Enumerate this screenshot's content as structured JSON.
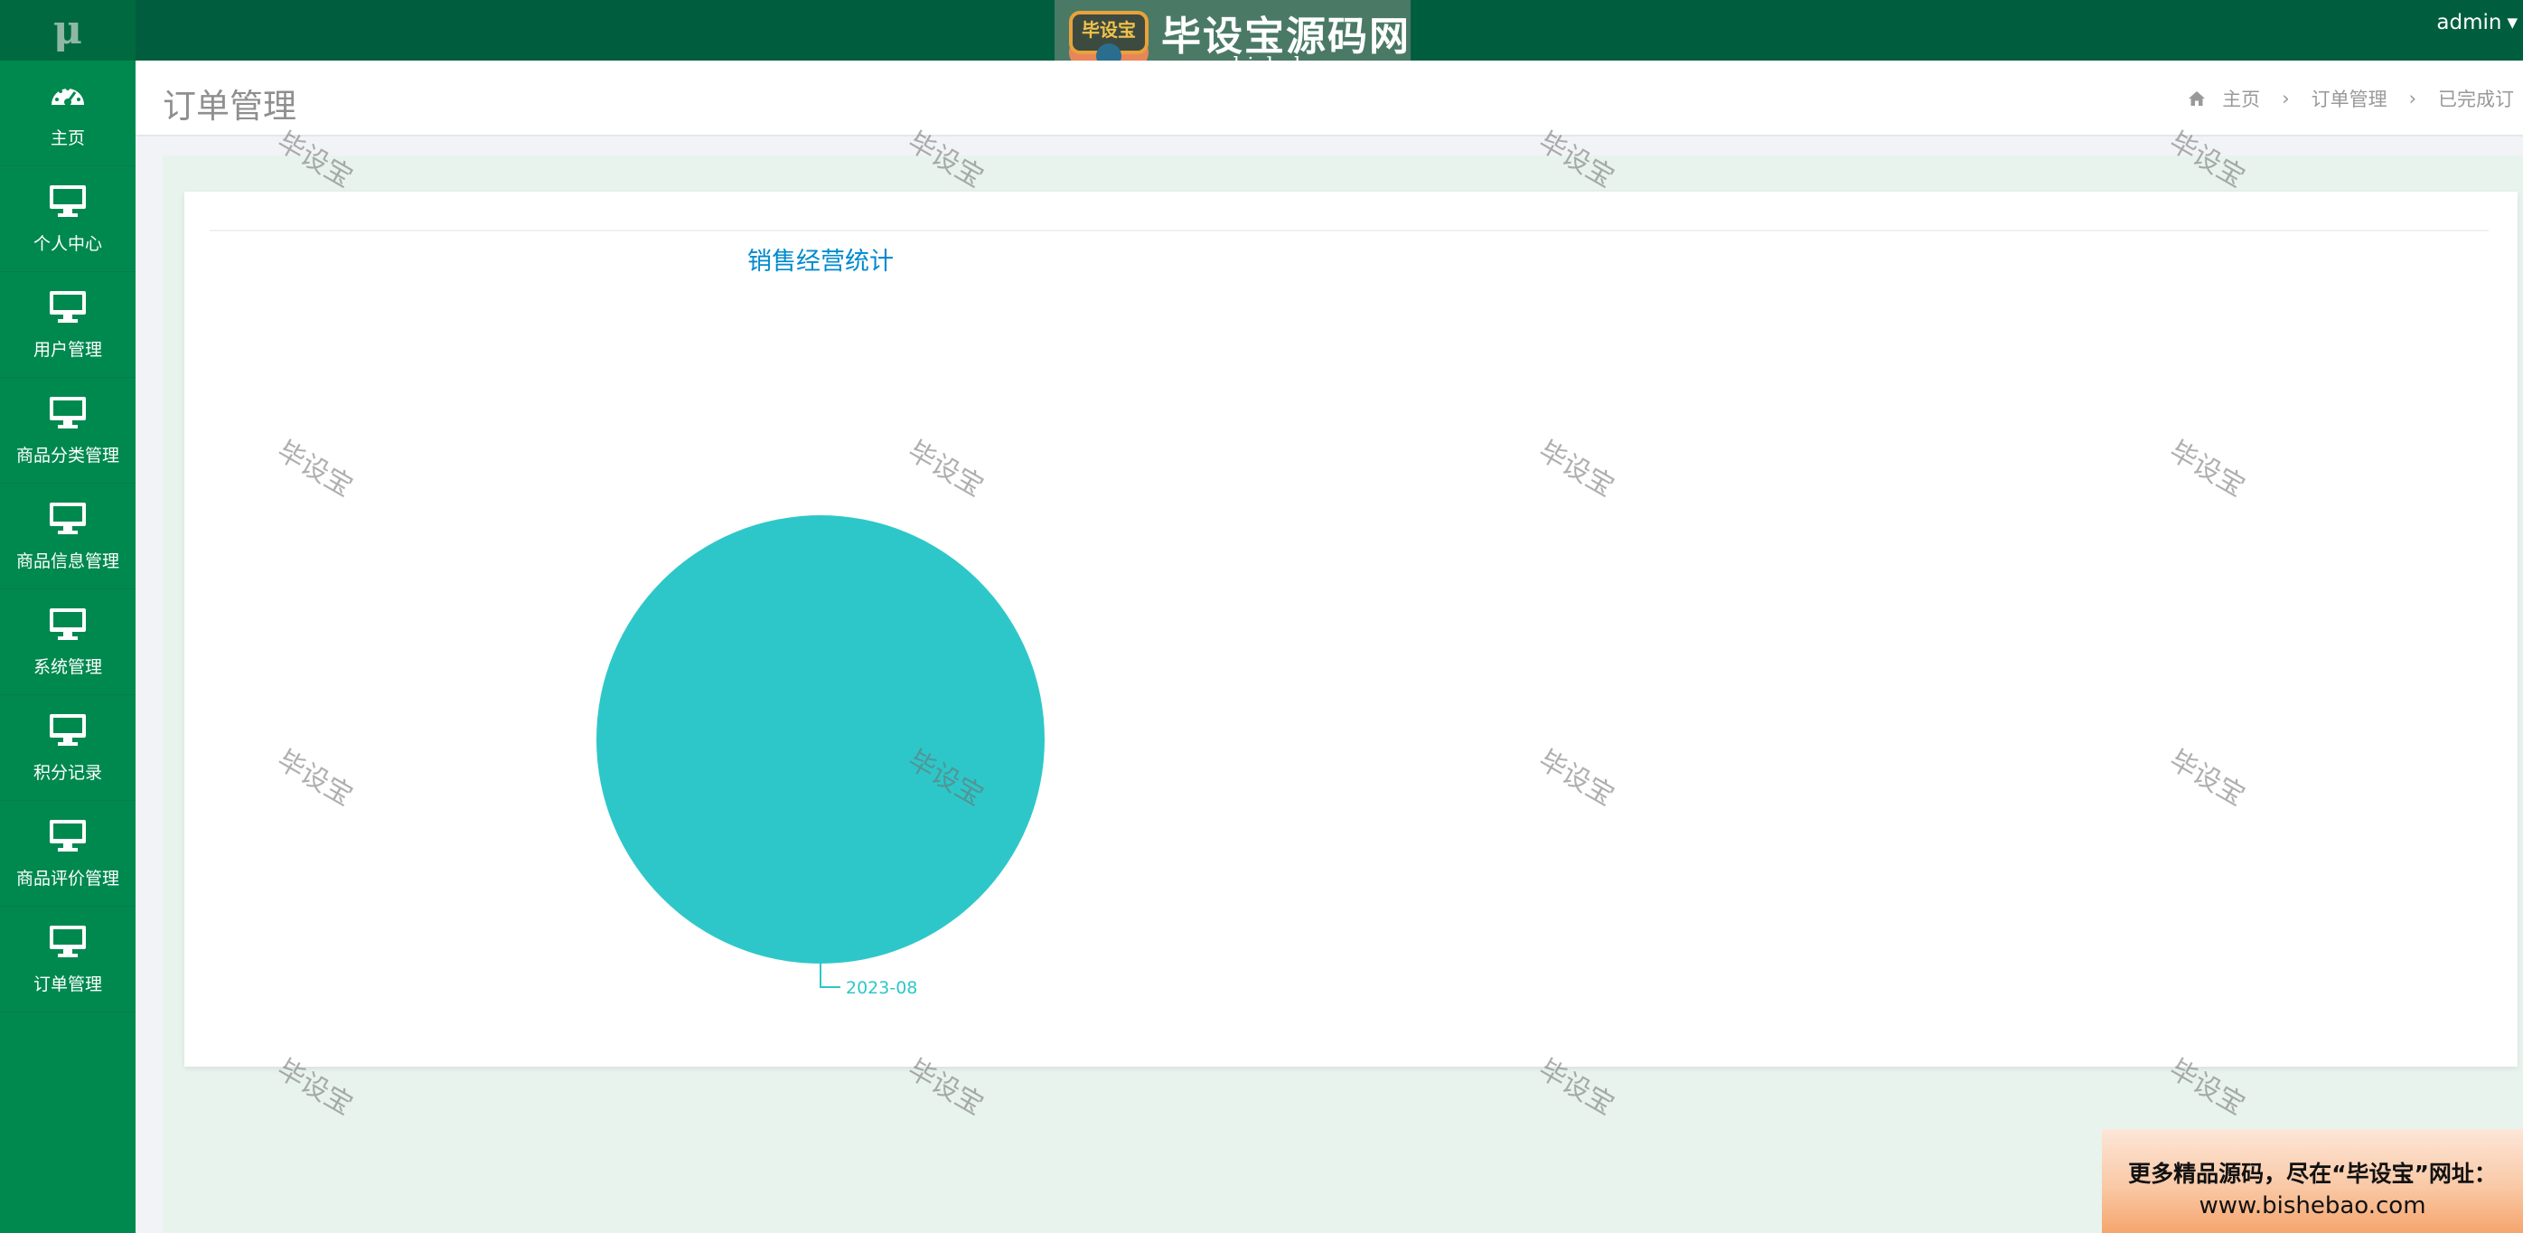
{
  "app": {
    "logo_text": "μ",
    "user": "admin"
  },
  "brand": {
    "badge_text": "毕设宝",
    "name": "毕设宝源码网",
    "url": "www.bishebao.com"
  },
  "sidebar": {
    "items": [
      {
        "label": "主页",
        "icon": "dashboard-icon"
      },
      {
        "label": "个人中心",
        "icon": "monitor-icon"
      },
      {
        "label": "用户管理",
        "icon": "monitor-icon"
      },
      {
        "label": "商品分类管理",
        "icon": "monitor-icon"
      },
      {
        "label": "商品信息管理",
        "icon": "monitor-icon"
      },
      {
        "label": "系统管理",
        "icon": "monitor-icon"
      },
      {
        "label": "积分记录",
        "icon": "monitor-icon"
      },
      {
        "label": "商品评价管理",
        "icon": "monitor-icon"
      },
      {
        "label": "订单管理",
        "icon": "monitor-icon"
      }
    ]
  },
  "header": {
    "title": "订单管理",
    "breadcrumb": [
      "主页",
      "订单管理",
      "已完成订"
    ]
  },
  "watermark_text": "毕设宝",
  "promo": {
    "line1": "更多精品源码，尽在“毕设宝”网址：",
    "line2": "www.bishebao.com"
  },
  "colors": {
    "topbar": "#005e3f",
    "sidebar": "#00894f",
    "content_bg": "#e8f3ed",
    "pie_slice": "#2ec7c9",
    "chart_title": "#008acd"
  },
  "chart_data": {
    "type": "pie",
    "title": "销售经营统计",
    "categories": [
      "2023-08"
    ],
    "values": [
      100
    ],
    "legend": "none"
  }
}
